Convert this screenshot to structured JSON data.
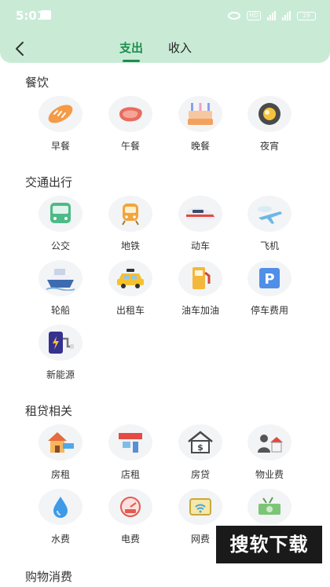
{
  "status_bar": {
    "time": "5:01",
    "hd": "HD",
    "net1": "5G",
    "net2": "5G",
    "battery": "29"
  },
  "tabs": [
    {
      "label": "支出"
    },
    {
      "label": "收入"
    }
  ],
  "sections": [
    {
      "title": "餐饮",
      "items": [
        {
          "label": "早餐",
          "icon": "bread-icon"
        },
        {
          "label": "午餐",
          "icon": "steak-icon"
        },
        {
          "label": "晚餐",
          "icon": "birthday-cake-icon"
        },
        {
          "label": "夜宵",
          "icon": "night-snack-icon"
        }
      ]
    },
    {
      "title": "交通出行",
      "items": [
        {
          "label": "公交",
          "icon": "bus-icon"
        },
        {
          "label": "地铁",
          "icon": "subway-icon"
        },
        {
          "label": "动车",
          "icon": "bullet-train-icon"
        },
        {
          "label": "飞机",
          "icon": "airplane-icon"
        },
        {
          "label": "轮船",
          "icon": "ship-icon"
        },
        {
          "label": "出租车",
          "icon": "taxi-icon"
        },
        {
          "label": "油车加油",
          "icon": "fuel-pump-icon"
        },
        {
          "label": "停车费用",
          "icon": "parking-icon"
        },
        {
          "label": "新能源",
          "icon": "ev-charging-icon"
        }
      ]
    },
    {
      "title": "租贷相关",
      "items": [
        {
          "label": "房租",
          "icon": "rent-house-icon"
        },
        {
          "label": "店租",
          "icon": "shop-icon"
        },
        {
          "label": "房贷",
          "icon": "mortgage-house-icon"
        },
        {
          "label": "物业费",
          "icon": "property-fee-icon"
        },
        {
          "label": "水费",
          "icon": "water-drop-icon"
        },
        {
          "label": "电费",
          "icon": "electric-meter-icon"
        },
        {
          "label": "网费",
          "icon": "wifi-router-icon"
        },
        {
          "label": "",
          "icon": "money-icon"
        }
      ]
    },
    {
      "title": "购物消费",
      "items": []
    }
  ],
  "watermark": "搜软下载",
  "colors": {
    "header": "#c9ebd6",
    "accent": "#1b8f4d",
    "icon_bg": "#f3f4f6"
  }
}
